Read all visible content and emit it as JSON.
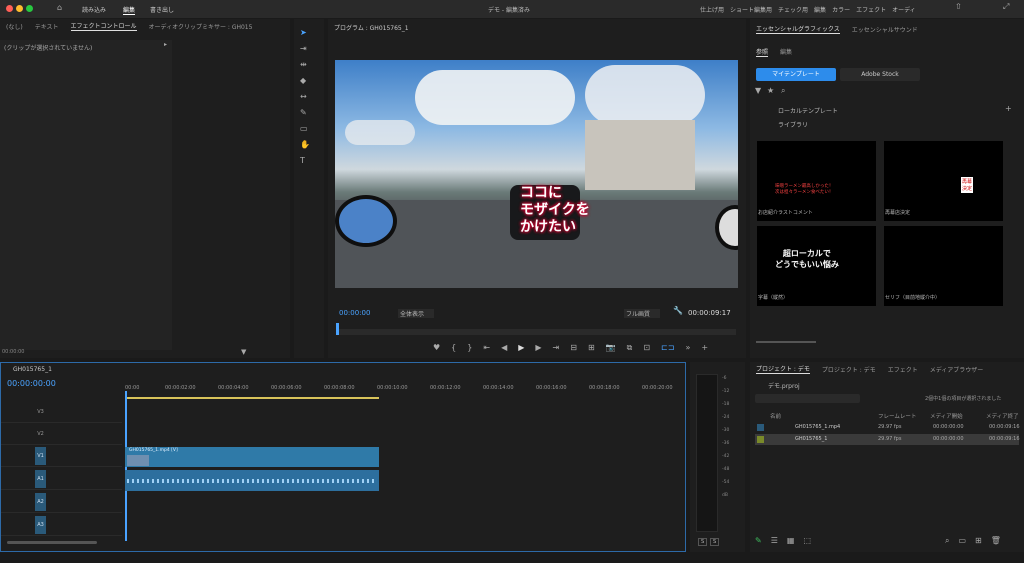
{
  "topbar": {
    "tabs": [
      "読み込み",
      "編集",
      "書き出し"
    ],
    "active": "編集",
    "title": "デモ - 編集済み",
    "workspaces": [
      "仕上げ用",
      "ショート編集用",
      "チェック用",
      "編集",
      "カラー",
      "エフェクト",
      "オーディ"
    ]
  },
  "left_panel": {
    "tabs": [
      "(なし)",
      "テキスト",
      "エフェクトコントロール",
      "オーディオクリップミキサー : GH015"
    ],
    "empty_msg": "(クリップが選択されていません)",
    "timecode": "00:00:00"
  },
  "program": {
    "title": "プログラム : GH015765_1",
    "timecode": "00:00:00",
    "timecode_end": "00:00:09:17",
    "fit": "全体表示",
    "quality": "フル画質",
    "overlay_text": "ココに\nモザイクを\nかけたい"
  },
  "essential": {
    "tabs": [
      "エッセンシャルグラフィックス",
      "エッセンシャルサウンド"
    ],
    "subtabs": [
      "参照",
      "編集"
    ],
    "scope": [
      "マイテンプレート",
      "Adobe Stock"
    ],
    "folders": [
      "ローカルテンプレート",
      "ライブラリ"
    ],
    "templates": [
      {
        "label": "お店紹介ラストコメント",
        "text": "味噌ラーメン最高しかった！\n次は担々ラーメン食べたい！"
      },
      {
        "label": "再幕店決定",
        "text": "再幕\n決定"
      },
      {
        "label": "字幕（縦然）",
        "text": "超ローカルで\nどうでもいい悩み"
      },
      {
        "label": "セリフ（目前地縦介中）",
        "text": ""
      }
    ]
  },
  "timeline": {
    "title": "GH015765_1",
    "timecode": "00:00:00:00",
    "ruler": [
      "00:00",
      "00:00:02:00",
      "00:00:04:00",
      "00:00:06:00",
      "00:00:08:00",
      "00:00:10:00",
      "00:00:12:00",
      "00:00:14:00",
      "00:00:16:00",
      "00:00:18:00",
      "00:00:20:00"
    ],
    "tracks": [
      "V3",
      "V2",
      "V1",
      "A1",
      "A2",
      "A3"
    ],
    "clip_video": "GH015765_1.mp4 [V]"
  },
  "project": {
    "tabs": [
      "プロジェクト : デモ",
      "プロジェクト : デモ",
      "エフェクト",
      "メディアブラウザー"
    ],
    "file": "デモ.prproj",
    "status": "2個中1個の項目が選択されました",
    "columns": [
      "名前",
      "フレームレート",
      "メディア開始",
      "メディア終了"
    ],
    "rows": [
      {
        "name": "GH015765_1.mp4",
        "fps": "29.97 fps",
        "start": "00:00:00:00",
        "end": "00:00:09:16"
      },
      {
        "name": "GH015765_1",
        "fps": "29.97 fps",
        "start": "00:00:00:00",
        "end": "00:00:09:16"
      }
    ]
  },
  "meter": {
    "ticks": [
      "-6",
      "-12",
      "-18",
      "-24",
      "-30",
      "-36",
      "-42",
      "-48",
      "-54",
      "dB"
    ],
    "solo": [
      "S",
      "S"
    ]
  },
  "colors": {
    "accent": "#2d8ceb",
    "clip": "#2f7aa8",
    "audio": "#2d6f9e",
    "timecode": "#4aa3ff"
  }
}
